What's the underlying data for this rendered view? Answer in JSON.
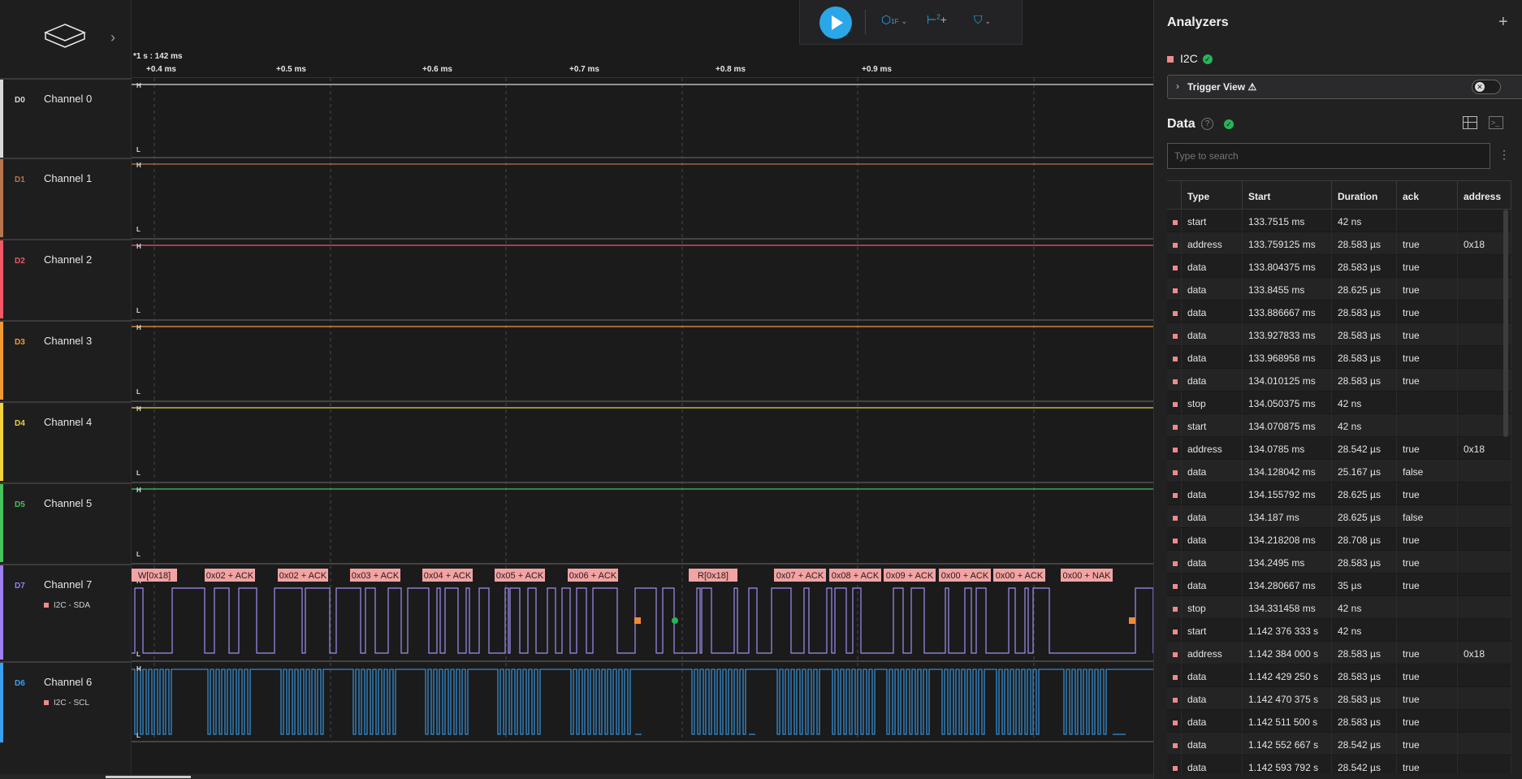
{
  "channels": [
    {
      "id": "D0",
      "name": "Channel 0",
      "color": "#d9d9d9",
      "sub": ""
    },
    {
      "id": "D1",
      "name": "Channel 1",
      "color": "#b7744e",
      "sub": ""
    },
    {
      "id": "D2",
      "name": "Channel 2",
      "color": "#f0586a",
      "sub": ""
    },
    {
      "id": "D3",
      "name": "Channel 3",
      "color": "#f39a35",
      "sub": ""
    },
    {
      "id": "D4",
      "name": "Channel 4",
      "color": "#f2d23c",
      "sub": ""
    },
    {
      "id": "D5",
      "name": "Channel 5",
      "color": "#46c35e",
      "sub": ""
    },
    {
      "id": "D7",
      "name": "Channel 7",
      "color": "#9e7ff0",
      "sub": "I2C - SDA"
    },
    {
      "id": "D6",
      "name": "Channel 6",
      "color": "#3aa0ef",
      "sub": "I2C - SCL"
    }
  ],
  "toolbar": {
    "icon1": "1F",
    "icon2": "2",
    "icon2_suffix": "+"
  },
  "timeline": {
    "offset": "*1 s : 142 ms",
    "ticks": [
      "+0.4 ms",
      "+0.5 ms",
      "+0.6 ms",
      "+0.7 ms",
      "+0.8 ms",
      "+0.9 ms"
    ]
  },
  "level_labels": {
    "high": "H",
    "low": "L"
  },
  "decoded_labels": [
    "W[0x18]",
    "0x02 + ACK",
    "0x02 + ACK",
    "0x03 + ACK",
    "0x04 + ACK",
    "0x05 + ACK",
    "0x06 + ACK",
    "R[0x18]",
    "0x07 + ACK",
    "0x08 + ACK",
    "0x09 + ACK",
    "0x00 + ACK",
    "0x00 + ACK",
    "0x00 + NAK"
  ],
  "panel": {
    "analyzers_title": "Analyzers",
    "add": "+",
    "analyzer_name": "I2C",
    "ok_mark": "✓",
    "trigger_label": "Trigger View ⚠",
    "toggle_mark": "✕",
    "data_title": "Data",
    "help_mark": "?",
    "term_mark": ">_",
    "more": "⋮",
    "search_placeholder": "Type to search"
  },
  "table": {
    "headers": [
      "Type",
      "Start",
      "Duration",
      "ack",
      "address"
    ],
    "rows": [
      [
        "start",
        "133.7515 ms",
        "42 ns",
        "",
        ""
      ],
      [
        "address",
        "133.759125 ms",
        "28.583 µs",
        "true",
        "0x18"
      ],
      [
        "data",
        "133.804375 ms",
        "28.583 µs",
        "true",
        ""
      ],
      [
        "data",
        "133.8455 ms",
        "28.625 µs",
        "true",
        ""
      ],
      [
        "data",
        "133.886667 ms",
        "28.583 µs",
        "true",
        ""
      ],
      [
        "data",
        "133.927833 ms",
        "28.583 µs",
        "true",
        ""
      ],
      [
        "data",
        "133.968958 ms",
        "28.583 µs",
        "true",
        ""
      ],
      [
        "data",
        "134.010125 ms",
        "28.583 µs",
        "true",
        ""
      ],
      [
        "stop",
        "134.050375 ms",
        "42 ns",
        "",
        ""
      ],
      [
        "start",
        "134.070875 ms",
        "42 ns",
        "",
        ""
      ],
      [
        "address",
        "134.0785 ms",
        "28.542 µs",
        "true",
        "0x18"
      ],
      [
        "data",
        "134.128042 ms",
        "25.167 µs",
        "false",
        ""
      ],
      [
        "data",
        "134.155792 ms",
        "28.625 µs",
        "true",
        ""
      ],
      [
        "data",
        "134.187 ms",
        "28.625 µs",
        "false",
        ""
      ],
      [
        "data",
        "134.218208 ms",
        "28.708 µs",
        "true",
        ""
      ],
      [
        "data",
        "134.2495 ms",
        "28.583 µs",
        "true",
        ""
      ],
      [
        "data",
        "134.280667 ms",
        "35 µs",
        "true",
        ""
      ],
      [
        "stop",
        "134.331458 ms",
        "42 ns",
        "",
        ""
      ],
      [
        "start",
        "1.142 376 333 s",
        "42 ns",
        "",
        ""
      ],
      [
        "address",
        "1.142 384 000 s",
        "28.583 µs",
        "true",
        "0x18"
      ],
      [
        "data",
        "1.142 429 250 s",
        "28.583 µs",
        "true",
        ""
      ],
      [
        "data",
        "1.142 470 375 s",
        "28.583 µs",
        "true",
        ""
      ],
      [
        "data",
        "1.142 511 500 s",
        "28.583 µs",
        "true",
        ""
      ],
      [
        "data",
        "1.142 552 667 s",
        "28.542 µs",
        "true",
        ""
      ],
      [
        "data",
        "1.142 593 792 s",
        "28.542 µs",
        "true",
        ""
      ]
    ]
  }
}
